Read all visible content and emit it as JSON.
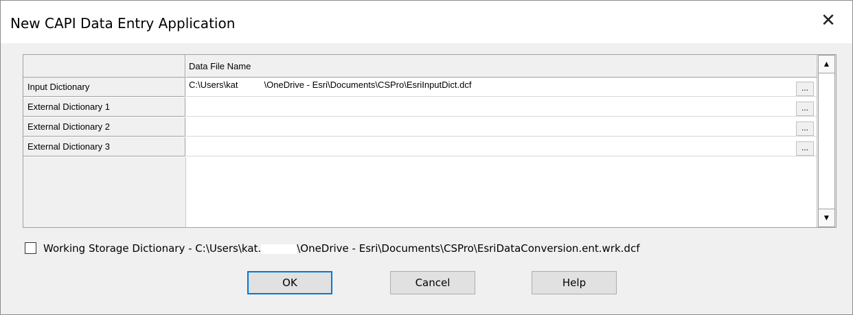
{
  "window": {
    "title": "New CAPI Data Entry Application",
    "close_glyph": "✕"
  },
  "grid": {
    "column_header": "Data File Name",
    "browse_label": "...",
    "rows": [
      {
        "label": "Input Dictionary",
        "value_a": "C:\\Users\\kat",
        "value_b": "\\OneDrive - Esri\\Documents\\CSPro\\EsriInputDict.dcf"
      },
      {
        "label": "External Dictionary 1",
        "value_a": "",
        "value_b": ""
      },
      {
        "label": "External Dictionary 2",
        "value_a": "",
        "value_b": ""
      },
      {
        "label": "External Dictionary 3",
        "value_a": "",
        "value_b": ""
      }
    ],
    "scroll_up": "▲",
    "scroll_down": "▼"
  },
  "working_storage": {
    "checked": false,
    "label_a": "Working Storage Dictionary - C:\\Users\\kat.",
    "label_b": "\\OneDrive - Esri\\Documents\\CSPro\\EsriDataConversion.ent.wrk.dcf"
  },
  "buttons": {
    "ok": "OK",
    "cancel": "Cancel",
    "help": "Help"
  }
}
